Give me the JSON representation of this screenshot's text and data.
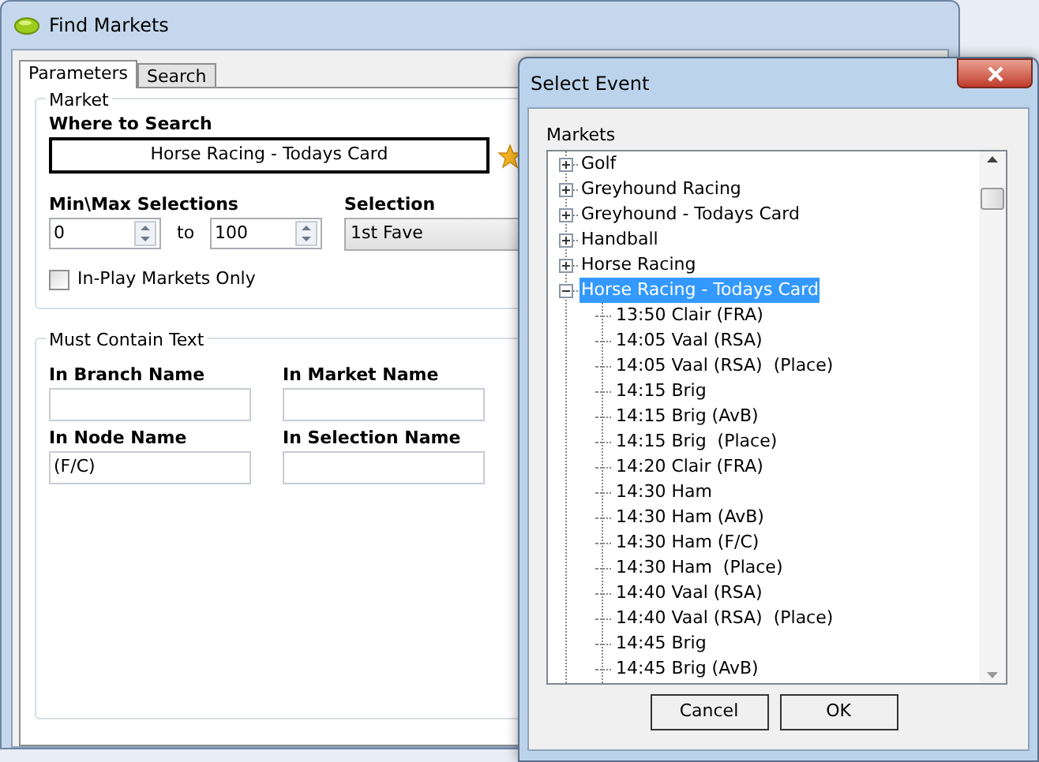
{
  "main_window": {
    "title": "Find Markets",
    "tabs": [
      {
        "label": "Parameters",
        "selected": true
      },
      {
        "label": "Search",
        "selected": false
      }
    ],
    "market_group": {
      "title": "Market",
      "where_to_search": {
        "label": "Where to Search",
        "value": "Horse Racing - Todays Card"
      },
      "min_max": {
        "label": "Min\\Max Selections",
        "min": "0",
        "to": "to",
        "max": "100"
      },
      "selection": {
        "label": "Selection",
        "value": "1st Fave"
      },
      "in_play_only": {
        "label": "In-Play Markets Only",
        "checked": false
      }
    },
    "must_contain_group": {
      "title": "Must Contain Text",
      "fields": [
        {
          "label": "In Branch Name"
        },
        {
          "label": "In Market Name"
        },
        {
          "label": "In Node Name",
          "value": "(F/C)"
        },
        {
          "label": "In Selection Name"
        }
      ]
    }
  },
  "select_event_dialog": {
    "title": "Select Event",
    "markets_label": "Markets",
    "tree": [
      {
        "label": "Golf",
        "expanded": false,
        "selected": false
      },
      {
        "label": "Greyhound Racing",
        "expanded": false,
        "selected": false
      },
      {
        "label": "Greyhound - Todays Card",
        "expanded": false,
        "selected": false
      },
      {
        "label": "Handball",
        "expanded": false,
        "selected": false
      },
      {
        "label": "Horse Racing",
        "expanded": false,
        "selected": false
      },
      {
        "label": "Horse Racing - Todays Card",
        "expanded": true,
        "selected": true,
        "children": [
          {
            "label": "13:50 Clair (FRA)",
            "selected": false
          },
          {
            "label": "14:05 Vaal (RSA)",
            "selected": false
          },
          {
            "label": "14:05 Vaal (RSA)  (Place)",
            "selected": false
          },
          {
            "label": "14:15 Brig",
            "selected": false
          },
          {
            "label": "14:15 Brig (AvB)",
            "selected": false
          },
          {
            "label": "14:15 Brig  (Place)",
            "selected": false
          },
          {
            "label": "14:20 Clair (FRA)",
            "selected": false
          },
          {
            "label": "14:30 Ham",
            "selected": false
          },
          {
            "label": "14:30 Ham (AvB)",
            "selected": false
          },
          {
            "label": "14:30 Ham (F/C)",
            "selected": false
          },
          {
            "label": "14:30 Ham  (Place)",
            "selected": false
          },
          {
            "label": "14:40 Vaal (RSA)",
            "selected": false
          },
          {
            "label": "14:40 Vaal (RSA)  (Place)",
            "selected": false
          },
          {
            "label": "14:45 Brig",
            "selected": false
          },
          {
            "label": "14:45 Brig (AvB)",
            "selected": false
          }
        ]
      }
    ],
    "buttons": [
      "Cancel",
      "OK"
    ]
  }
}
